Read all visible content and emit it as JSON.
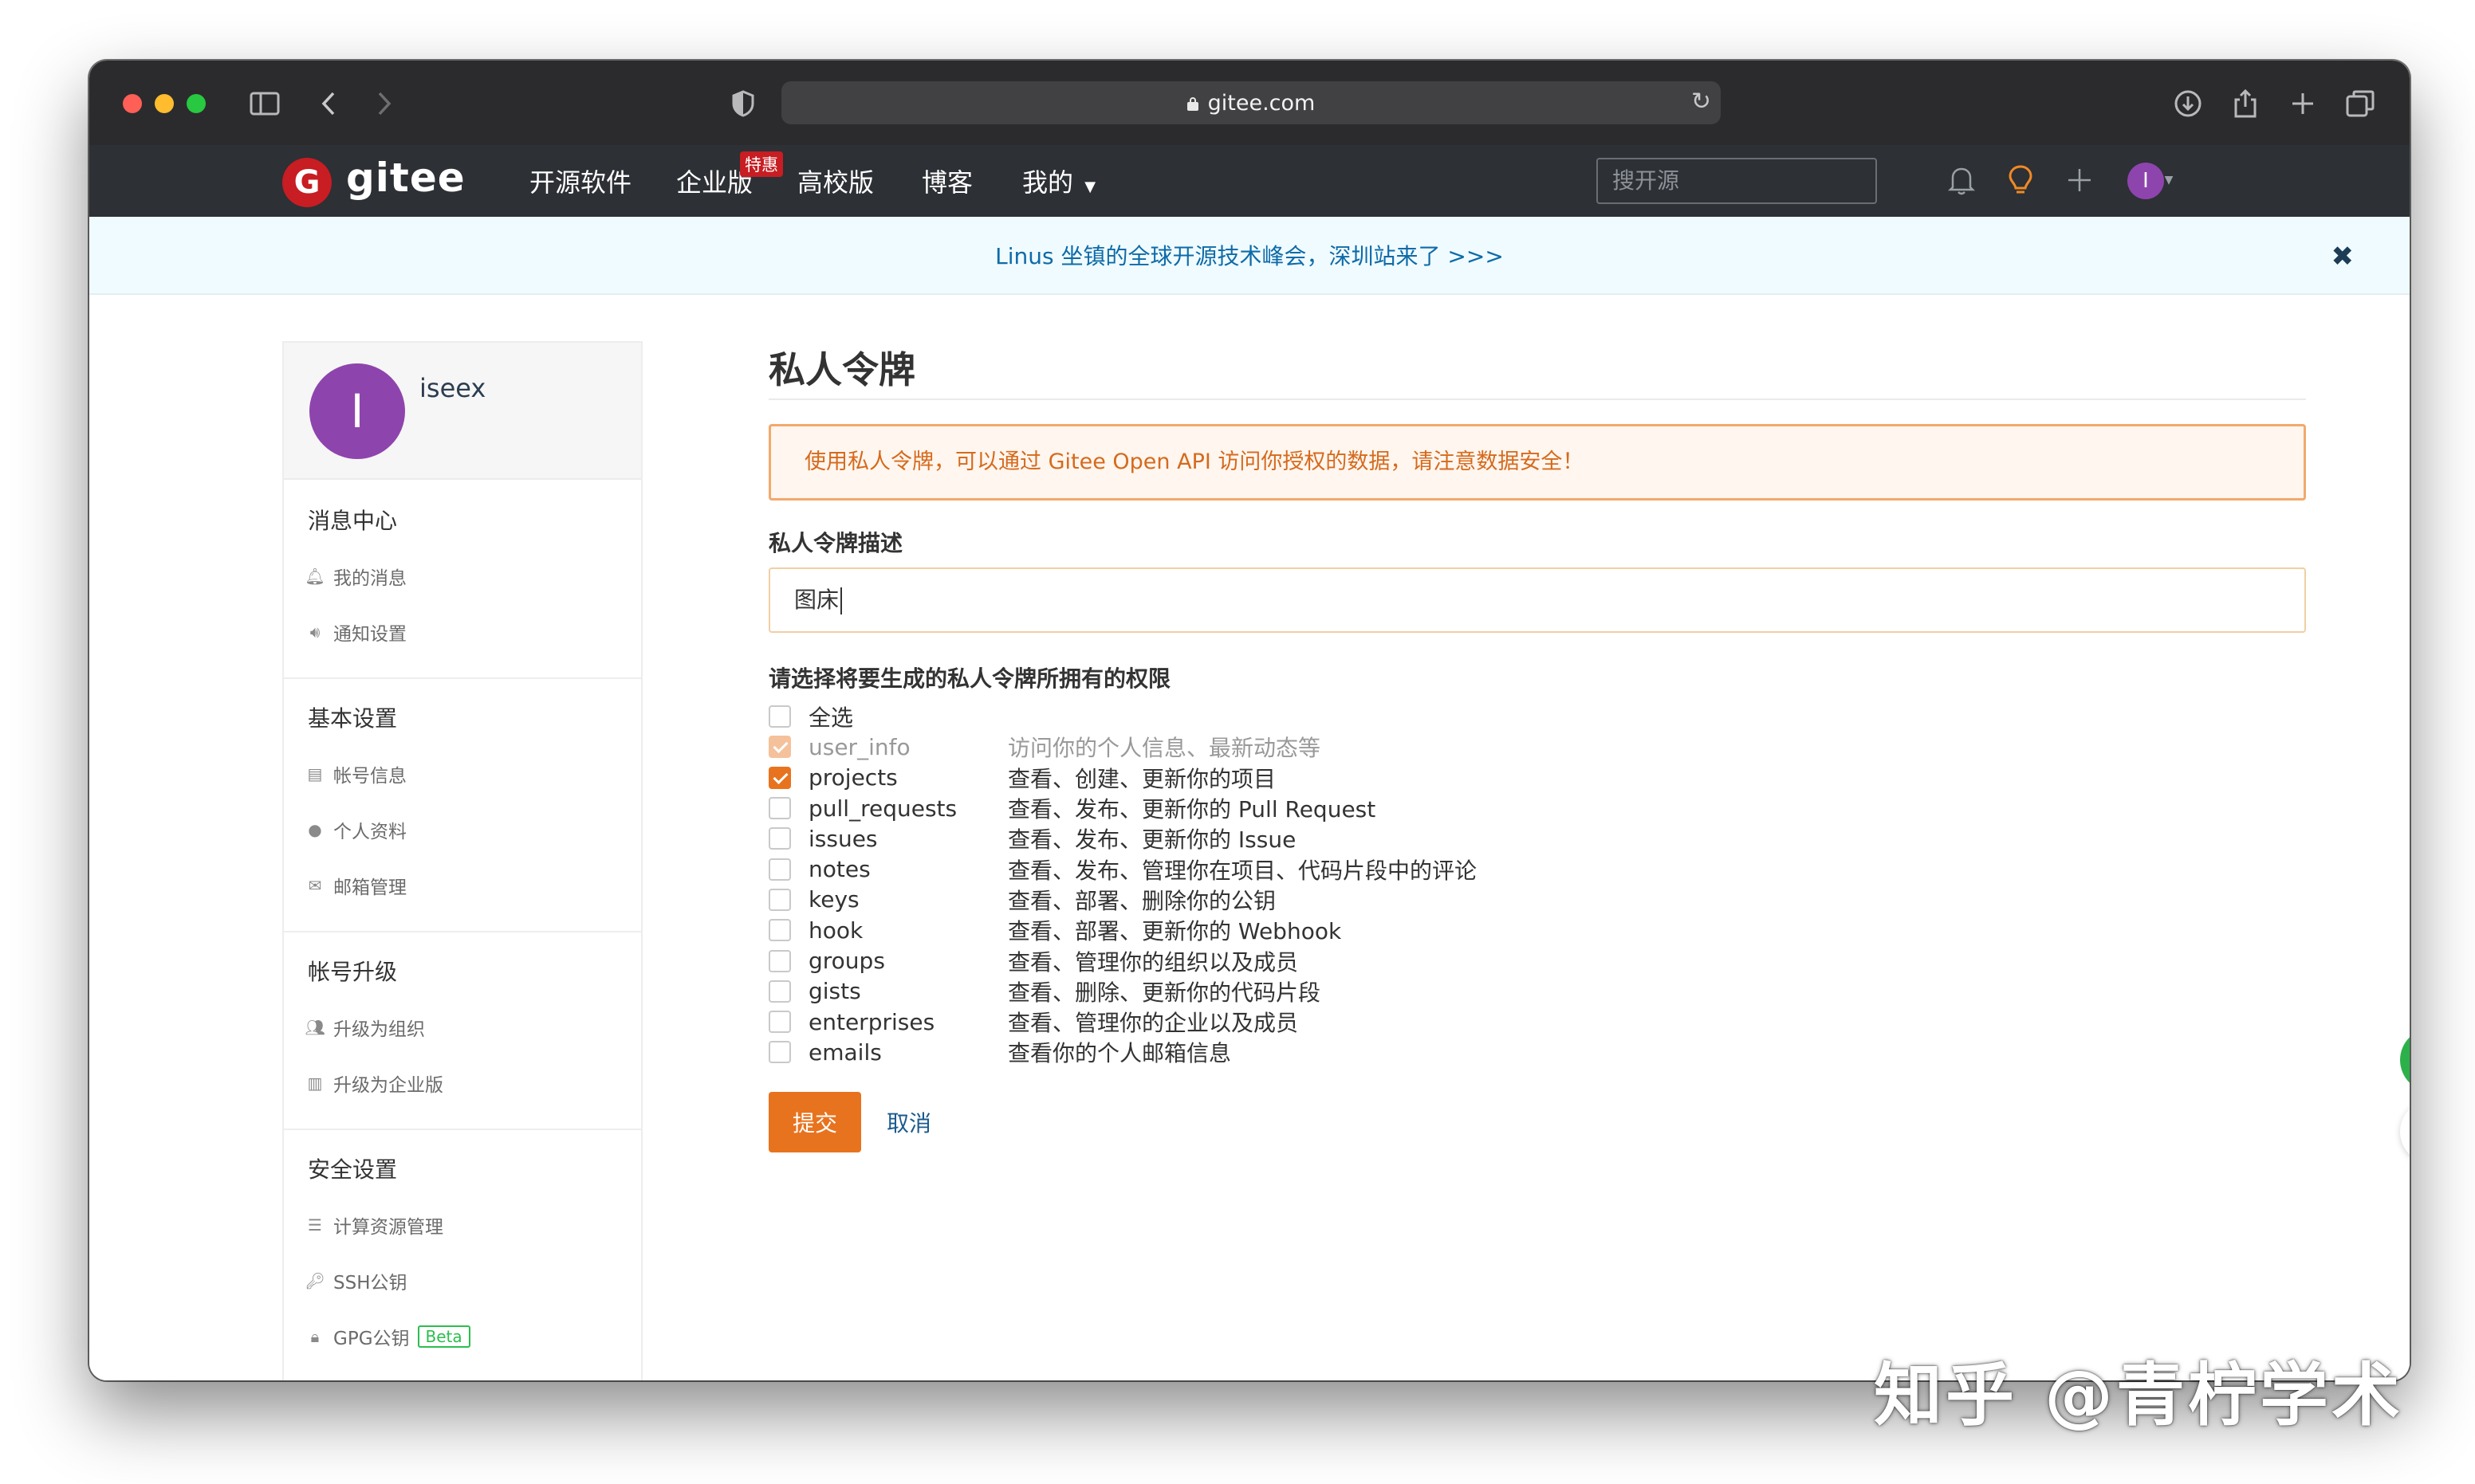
{
  "browser": {
    "url": "gitee.com"
  },
  "nav": {
    "logo": "gitee",
    "links": [
      "开源软件",
      "企业版",
      "高校版",
      "博客",
      "我的"
    ],
    "hot_badge": "特惠",
    "search_placeholder": "搜开源",
    "avatar_letter": "I"
  },
  "banner": {
    "text": "Linus 坐镇的全球开源技术峰会，深圳站来了 >>>",
    "close": "✖"
  },
  "sidebar": {
    "avatar_letter": "I",
    "username": "iseex",
    "sections": [
      {
        "title": "消息中心",
        "items": [
          {
            "label": "我的消息",
            "icon": "bell-icon"
          },
          {
            "label": "通知设置",
            "icon": "speaker-icon"
          }
        ]
      },
      {
        "title": "基本设置",
        "items": [
          {
            "label": "帐号信息",
            "icon": "id-card-icon"
          },
          {
            "label": "个人资料",
            "icon": "user-icon"
          },
          {
            "label": "邮箱管理",
            "icon": "envelope-icon"
          }
        ]
      },
      {
        "title": "帐号升级",
        "items": [
          {
            "label": "升级为组织",
            "icon": "users-icon"
          },
          {
            "label": "升级为企业版",
            "icon": "building-icon"
          }
        ]
      },
      {
        "title": "安全设置",
        "items": [
          {
            "label": "计算资源管理",
            "icon": "server-icon"
          },
          {
            "label": "SSH公钥",
            "icon": "key-icon"
          },
          {
            "label": "GPG公钥",
            "icon": "lock-icon",
            "badge": "Beta"
          }
        ]
      }
    ]
  },
  "main": {
    "title": "私人令牌",
    "notice": "使用私人令牌，可以通过 Gitee Open API 访问你授权的数据，请注意数据安全！",
    "desc_label": "私人令牌描述",
    "desc_value": "图床",
    "perm_title": "请选择将要生成的私人令牌所拥有的权限",
    "select_all": "全选",
    "permissions": [
      {
        "name": "user_info",
        "desc": "访问你的个人信息、最新动态等",
        "checked": true,
        "disabled": true
      },
      {
        "name": "projects",
        "desc": "查看、创建、更新你的项目",
        "checked": true,
        "disabled": false
      },
      {
        "name": "pull_requests",
        "desc": "查看、发布、更新你的 Pull Request",
        "checked": false,
        "disabled": false
      },
      {
        "name": "issues",
        "desc": "查看、发布、更新你的 Issue",
        "checked": false,
        "disabled": false
      },
      {
        "name": "notes",
        "desc": "查看、发布、管理你在项目、代码片段中的评论",
        "checked": false,
        "disabled": false
      },
      {
        "name": "keys",
        "desc": "查看、部署、删除你的公钥",
        "checked": false,
        "disabled": false
      },
      {
        "name": "hook",
        "desc": "查看、部署、更新你的 Webhook",
        "checked": false,
        "disabled": false
      },
      {
        "name": "groups",
        "desc": "查看、管理你的组织以及成员",
        "checked": false,
        "disabled": false
      },
      {
        "name": "gists",
        "desc": "查看、删除、更新你的代码片段",
        "checked": false,
        "disabled": false
      },
      {
        "name": "enterprises",
        "desc": "查看、管理你的企业以及成员",
        "checked": false,
        "disabled": false
      },
      {
        "name": "emails",
        "desc": "查看你的个人邮箱信息",
        "checked": false,
        "disabled": false
      }
    ],
    "submit": "提交",
    "cancel": "取消"
  },
  "floating": {
    "help": "?"
  },
  "watermark": "知乎 @青柠学术",
  "colors": {
    "accent": "#e8731e",
    "nav_bg": "#2d3035",
    "brand": "#c71d23",
    "help": "#2cb14a"
  }
}
